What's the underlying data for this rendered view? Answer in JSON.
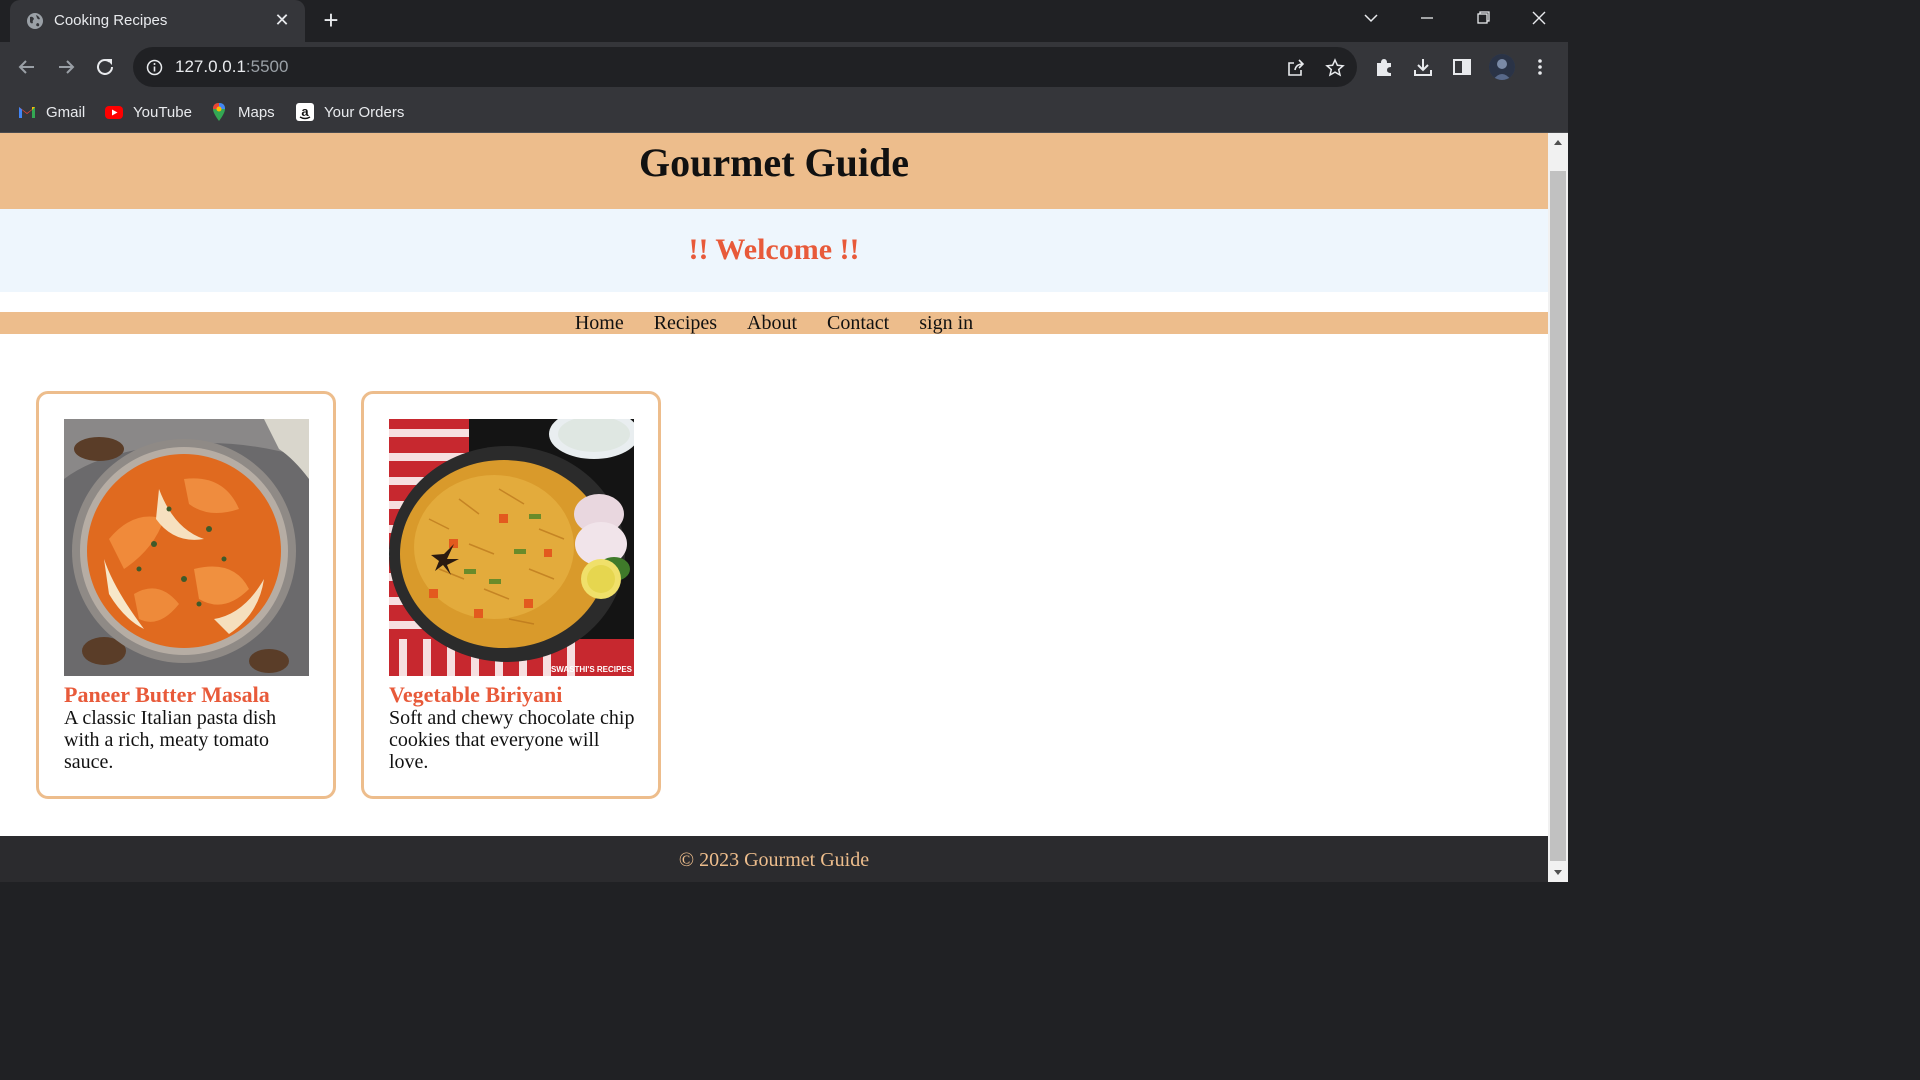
{
  "browser": {
    "tab_title": "Cooking Recipes",
    "url_host": "127.0.0.1",
    "url_port": ":5500",
    "icons": {
      "favicon": "globe-icon",
      "close": "close-icon",
      "new_tab": "plus-icon",
      "back": "arrow-left-icon",
      "forward": "arrow-right-icon",
      "reload": "reload-icon",
      "info": "info-icon",
      "share": "share-icon",
      "bookmark": "star-icon",
      "extensions": "puzzle-icon",
      "download": "download-icon",
      "side_panel": "side-panel-icon",
      "menu": "kebab-menu-icon"
    },
    "bookmarks": [
      {
        "label": "Gmail",
        "icon": "gmail-icon"
      },
      {
        "label": "YouTube",
        "icon": "youtube-icon"
      },
      {
        "label": "Maps",
        "icon": "maps-icon"
      },
      {
        "label": "Your Orders",
        "icon": "amazon-icon"
      }
    ]
  },
  "page": {
    "site_title": "Gourmet Guide",
    "welcome": "!! Welcome !!",
    "nav": [
      "Home",
      "Recipes",
      "About",
      "Contact",
      "sign in"
    ],
    "recipes": [
      {
        "title": "Paneer Butter Masala",
        "description": "A classic Italian pasta dish with a rich, meaty tomato sauce.",
        "image": "paneer-butter-masala-photo"
      },
      {
        "title": "Vegetable Biriyani",
        "description": "Soft and chewy chocolate chip cookies that everyone will love.",
        "image": "vegetable-biriyani-photo",
        "image_watermark": "SWASTHI'S RECIPES"
      }
    ],
    "footer": "© 2023 Gourmet Guide"
  },
  "colors": {
    "accent": "#edbd8c",
    "heading_red": "#e85a3a",
    "welcome_bg": "#eef6fd",
    "footer_bg": "#2b2b2e"
  }
}
